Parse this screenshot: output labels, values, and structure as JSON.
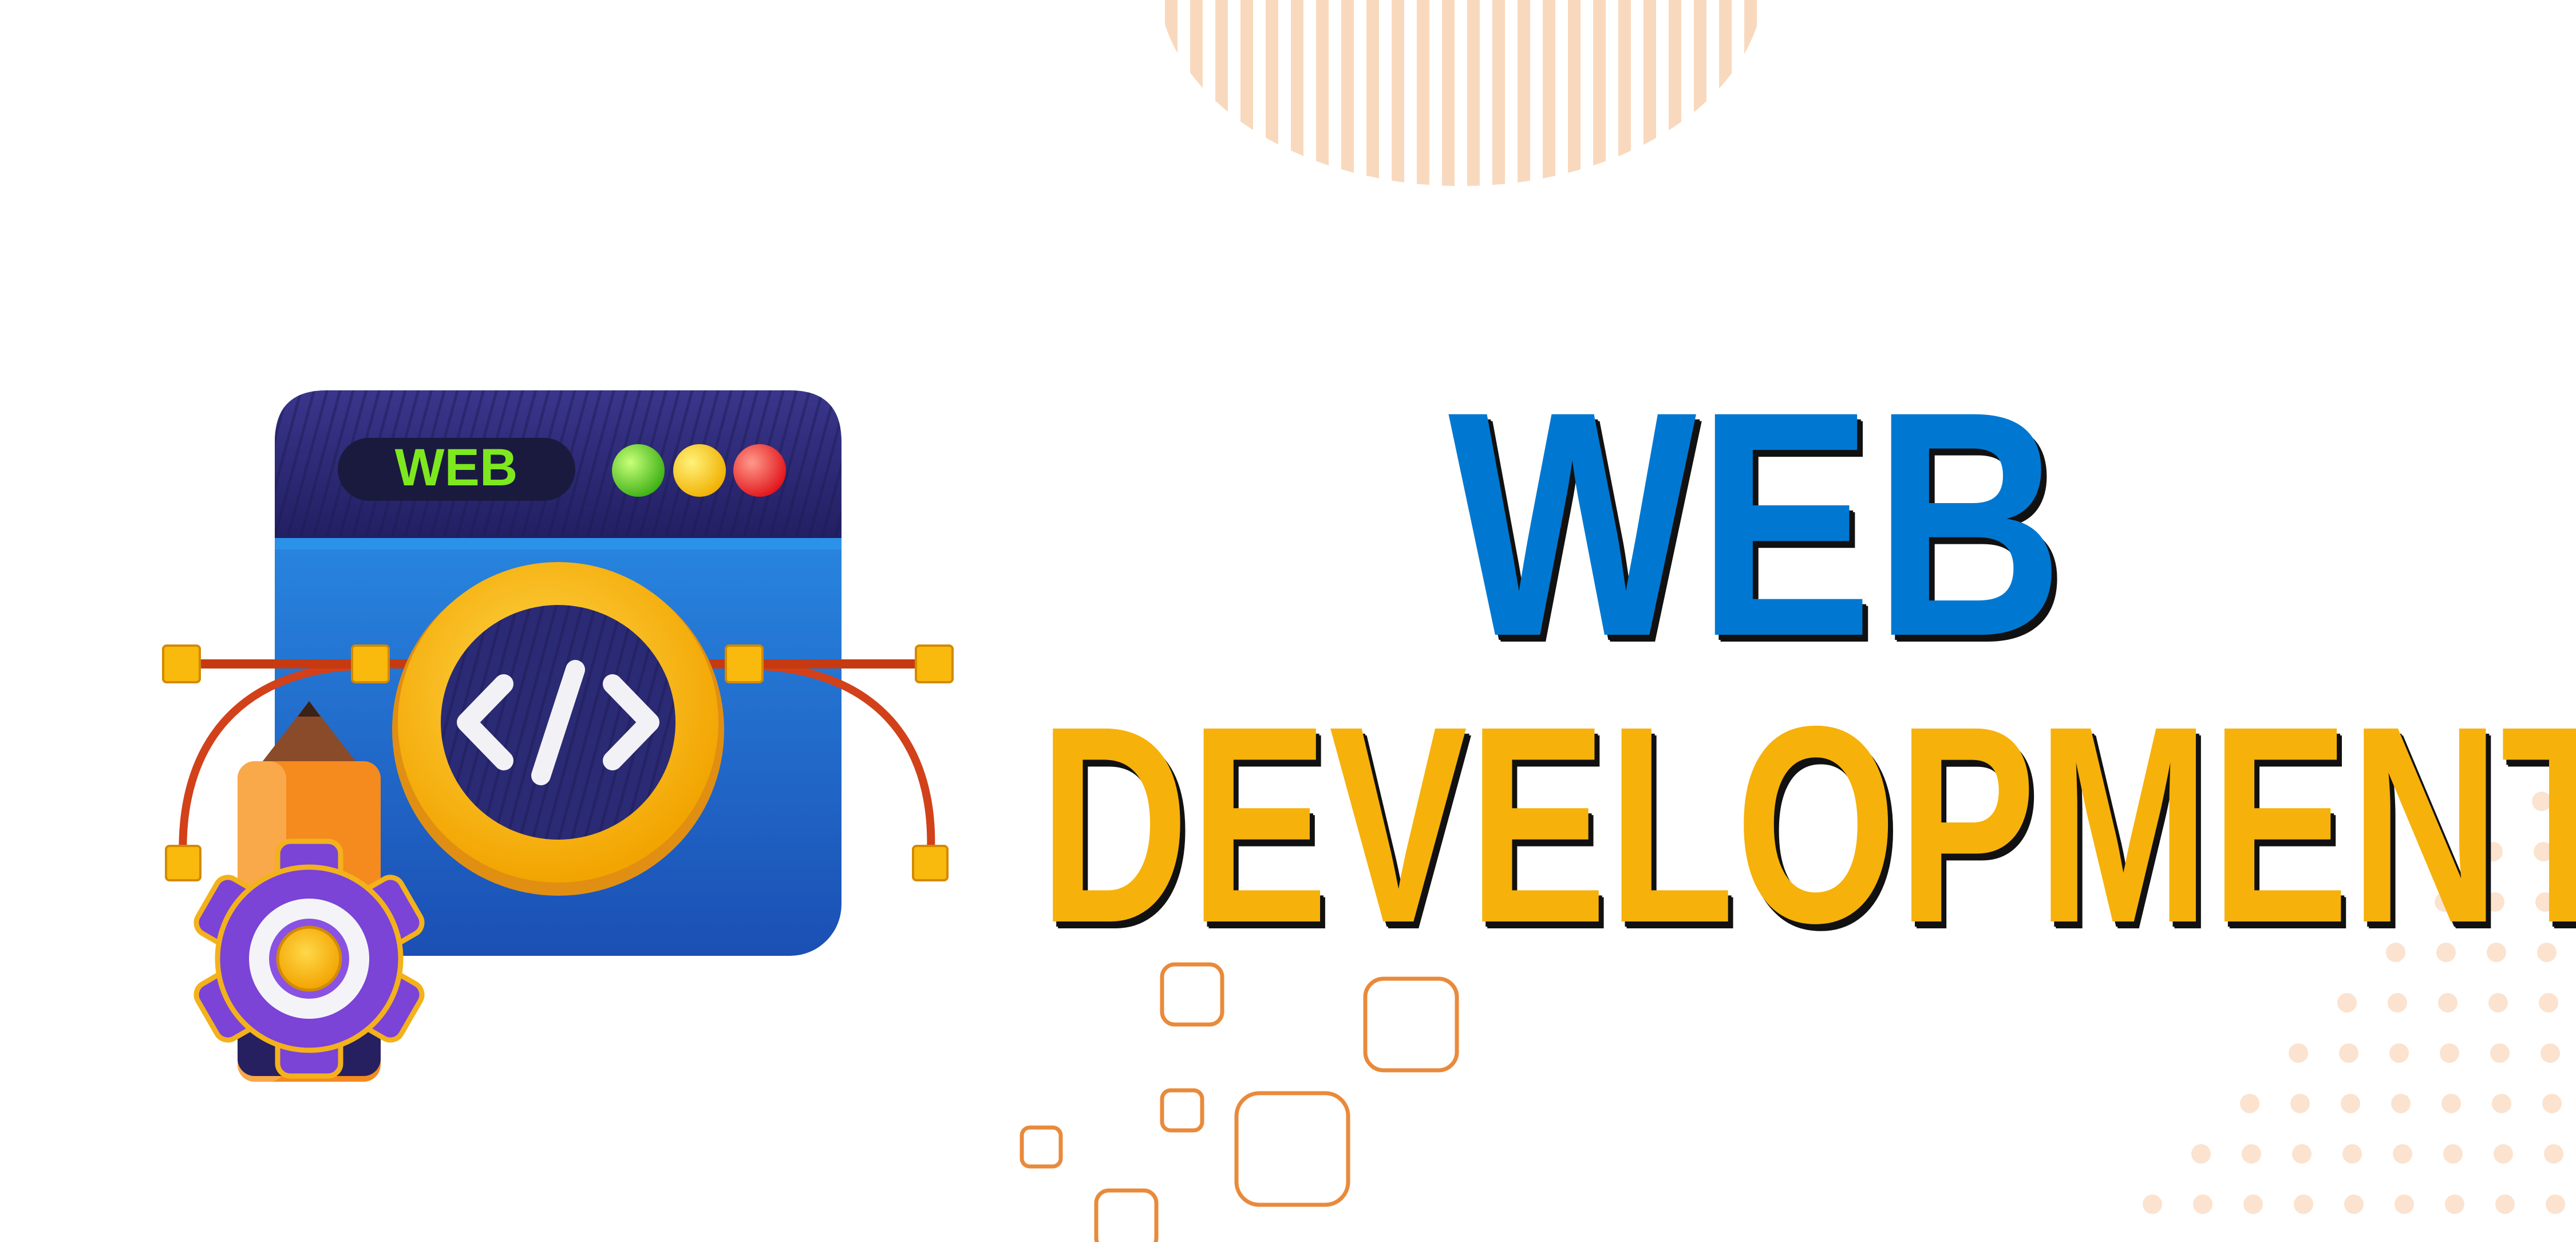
{
  "headline": {
    "line1": "WEB",
    "line2": "DEVELOPMENT"
  },
  "illustration": {
    "window_badge": "WEB",
    "code_glyph": "</>",
    "traffic_lights": [
      "green",
      "yellow",
      "red"
    ],
    "icons": [
      "browser-window-icon",
      "code-brackets-icon",
      "bezier-pen-tool-icon",
      "pencil-icon",
      "gear-icon"
    ]
  },
  "colors": {
    "web_blue": "#0078d2",
    "development_yellow": "#f6b10b",
    "window_top": "#2e2a78",
    "window_body": "#1d6fd1",
    "badge_text": "#7ee81e",
    "peach_stripes": "#f9d9bd",
    "orange_squares": "#e98a3b",
    "dot_pattern": "#fbe3d0"
  }
}
